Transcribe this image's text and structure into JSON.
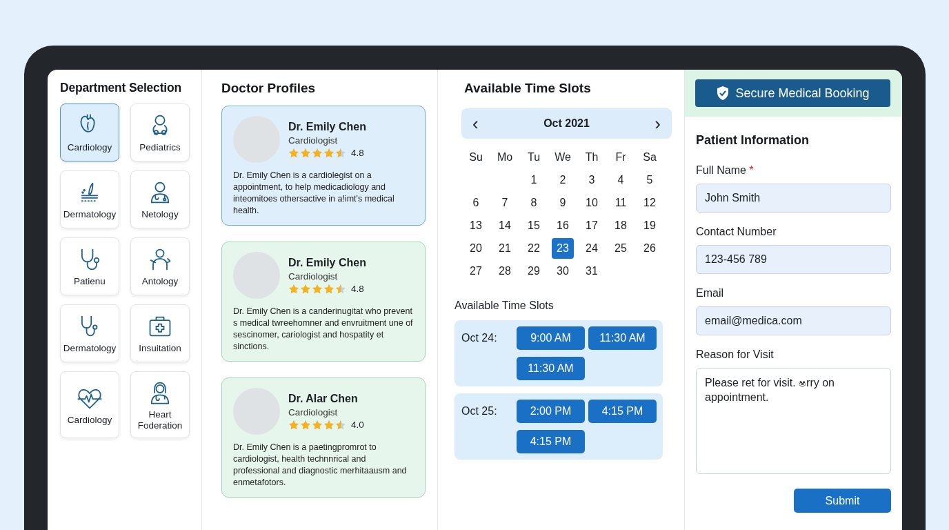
{
  "departments": {
    "title": "Department Selection",
    "items": [
      {
        "label": "Cardiology",
        "selected": true
      },
      {
        "label": "Pediatrics",
        "selected": false
      },
      {
        "label": "Dermatology",
        "selected": false
      },
      {
        "label": "Netology",
        "selected": false
      },
      {
        "label": "Patienu",
        "selected": false
      },
      {
        "label": "Antology",
        "selected": false
      },
      {
        "label": "Dermatology",
        "selected": false
      },
      {
        "label": "Insuitation",
        "selected": false
      },
      {
        "label": "Cardiology",
        "selected": false
      },
      {
        "label": "Heart Foderation",
        "selected": false
      }
    ]
  },
  "doctors": {
    "title": "Doctor Profiles",
    "items": [
      {
        "name": "Dr. Emily Chen",
        "specialty": "Cardiologist",
        "stars": 4.5,
        "rating": "4.8",
        "bio": "Dr. Emily Chen is a cardiolegist on a appointment, to help medicadiology and inteomitoes othersactive in a!imt's medical health.",
        "selected": true
      },
      {
        "name": "Dr. Emily Chen",
        "specialty": "Cardiologist",
        "stars": 4.5,
        "rating": "4.8",
        "bio": "Dr. Emily Chen is a canderinugitat who prevent s medical twreehomner and envruitment une of sescinomer, cariologist and hospatity et sinctions.",
        "selected": false
      },
      {
        "name": "Dr. Alar Chen",
        "specialty": "Cardiologist",
        "stars": 4.5,
        "rating": "4.0",
        "bio": "Dr. Emily Chen is a paetingpromrot to cardiologist, health technnrical and professional and diagnostic merhitaausm and enmetafotors.",
        "selected": false
      }
    ]
  },
  "calendar": {
    "title": "Available Time Slots",
    "prev": "‹",
    "month": "Oct 2021",
    "next": "›",
    "weekdays": [
      "Su",
      "Mo",
      "Tu",
      "We",
      "Th",
      "Fr",
      "Sa"
    ],
    "weeks": [
      [
        {
          "kind": "blank"
        },
        {
          "kind": "blank"
        },
        {
          "kind": "day",
          "day": "1",
          "selected": false
        },
        {
          "day": "2",
          "selected": false
        },
        {
          "day": "3",
          "selected": false
        },
        {
          "day": "4",
          "selected": false
        },
        {
          "day": "5",
          "selected": false
        }
      ],
      [
        {
          "day": "6",
          "selected": false
        },
        {
          "day": "7",
          "selected": false
        },
        {
          "day": "8",
          "selected": false
        },
        {
          "day": "9",
          "selected": false
        },
        {
          "day": "10",
          "selected": false
        },
        {
          "day": "11",
          "selected": false
        },
        {
          "day": "12",
          "selected": false
        }
      ],
      [
        {
          "day": "13",
          "selected": false
        },
        {
          "day": "14",
          "selected": false
        },
        {
          "day": "15",
          "selected": false
        },
        {
          "day": "16",
          "selected": false
        },
        {
          "day": "17",
          "selected": false
        },
        {
          "day": "18",
          "selected": false
        },
        {
          "day": "19",
          "selected": false
        }
      ],
      [
        {
          "day": "20",
          "selected": false
        },
        {
          "day": "21",
          "selected": false
        },
        {
          "day": "22",
          "selected": false
        },
        {
          "day": "23",
          "selected": true
        },
        {
          "day": "24",
          "selected": false
        },
        {
          "day": "25",
          "selected": false
        },
        {
          "day": "26",
          "selected": false
        }
      ],
      [
        {
          "day": "27",
          "selected": false
        },
        {
          "day": "28",
          "selected": false
        },
        {
          "day": "29",
          "selected": false
        },
        {
          "day": "30",
          "selected": false
        },
        {
          "day": "31",
          "selected": false
        }
      ]
    ]
  },
  "time_slots": {
    "title": "Available Time Slots",
    "days": [
      {
        "date": "Oct 24:",
        "slots": [
          "9:00 AM",
          "11:30 AM",
          "11:30 AM"
        ]
      },
      {
        "date": "Oct 25:",
        "slots": [
          "2:00 PM",
          "4:15 PM",
          "4:15 PM"
        ]
      }
    ]
  },
  "booking": {
    "banner": "Secure Medical Booking",
    "title": "Patient Information",
    "fields": [
      {
        "kind": "input",
        "label": "Full Name",
        "required": true,
        "value": "John Smith"
      },
      {
        "kind": "input",
        "label": "Contact Number",
        "required": false,
        "value": "123-456 789"
      },
      {
        "kind": "input",
        "label": "Email",
        "required": false,
        "value": "email@medica.com"
      },
      {
        "kind": "textarea",
        "label": "Reason for Visit",
        "required": false,
        "value": "Please ret for visit. ෂrry on appointment."
      }
    ],
    "required_mark": "*",
    "submit": "Submit"
  }
}
